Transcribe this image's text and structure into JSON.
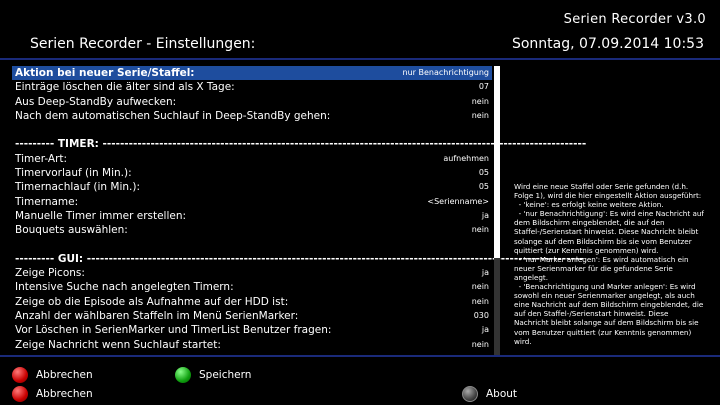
{
  "header": {
    "app_title": "Serien Recorder v3.0",
    "screen_title": "Serien Recorder - Einstellungen:",
    "datetime": "Sonntag, 07.09.2014  10:53"
  },
  "settings": [
    {
      "label": "Aktion bei neuer Serie/Staffel:",
      "value": "nur Benachrichtigung",
      "selected": true,
      "bold": true
    },
    {
      "label": "    Einträge löschen die älter sind als X Tage:",
      "value": "07"
    },
    {
      "label": "Aus Deep-StandBy aufwecken:",
      "value": "nein"
    },
    {
      "label": "Nach dem automatischen Suchlauf in Deep-StandBy gehen:",
      "value": "nein"
    },
    {
      "label": "",
      "value": ""
    },
    {
      "label": "---------  TIMER:  ---------------------------------------------------------------------------------------------------------------",
      "value": "",
      "section": true
    },
    {
      "label": "Timer-Art:",
      "value": "aufnehmen"
    },
    {
      "label": "Timervorlauf (in Min.):",
      "value": "05"
    },
    {
      "label": "Timernachlauf (in Min.):",
      "value": "05"
    },
    {
      "label": "Timername:",
      "value": "<Serienname>"
    },
    {
      "label": "Manuelle Timer immer erstellen:",
      "value": "ja"
    },
    {
      "label": "Bouquets auswählen:",
      "value": "nein"
    },
    {
      "label": "",
      "value": ""
    },
    {
      "label": "---------  GUI:  ------------------------------------------------------------------------------------------------------------------",
      "value": "",
      "section": true
    },
    {
      "label": "Zeige Picons:",
      "value": "ja"
    },
    {
      "label": "Intensive Suche nach angelegten Timern:",
      "value": "nein"
    },
    {
      "label": "Zeige ob die Episode als Aufnahme auf der HDD ist:",
      "value": "nein"
    },
    {
      "label": "Anzahl der wählbaren Staffeln im Menü SerienMarker:",
      "value": "030"
    },
    {
      "label": "Vor Löschen in SerienMarker und TimerList Benutzer fragen:",
      "value": "ja"
    },
    {
      "label": "Zeige Nachricht wenn Suchlauf startet:",
      "value": "nein"
    }
  ],
  "help_text": "Wird eine neue Staffel oder Serie gefunden (d.h. Folge 1), wird die hier eingestellt Aktion ausgeführt:\n  - 'keine': es erfolgt keine weitere Aktion.\n  - 'nur Benachrichtigung': Es wird eine Nachricht auf dem Bildschirm eingeblendet, die auf den Staffel-/Serienstart hinweist. Diese Nachricht bleibt solange auf dem Bildschirm bis sie vom Benutzer quittiert (zur Kenntnis genommen) wird.\n  - 'nur Marker anlegen': Es wird automatisch ein neuer Serienmarker für die gefundene Serie angelegt.\n  - 'Benachrichtigung und Marker anlegen': Es wird sowohl ein neuer Serienmarker angelegt, als auch eine Nachricht auf dem Bildschirm eingeblendet, die auf den Staffel-/Serienstart hinweist. Diese Nachricht bleibt solange auf dem Bildschirm bis sie vom Benutzer quittiert (zur Kenntnis genommen) wird.",
  "footer": {
    "red1_label": "Abbrechen",
    "green_label": "Speichern",
    "red2_label": "Abbrechen",
    "info_label": "About"
  },
  "colors": {
    "accent": "#1e4d9e",
    "divider": "#1a2a7a"
  }
}
